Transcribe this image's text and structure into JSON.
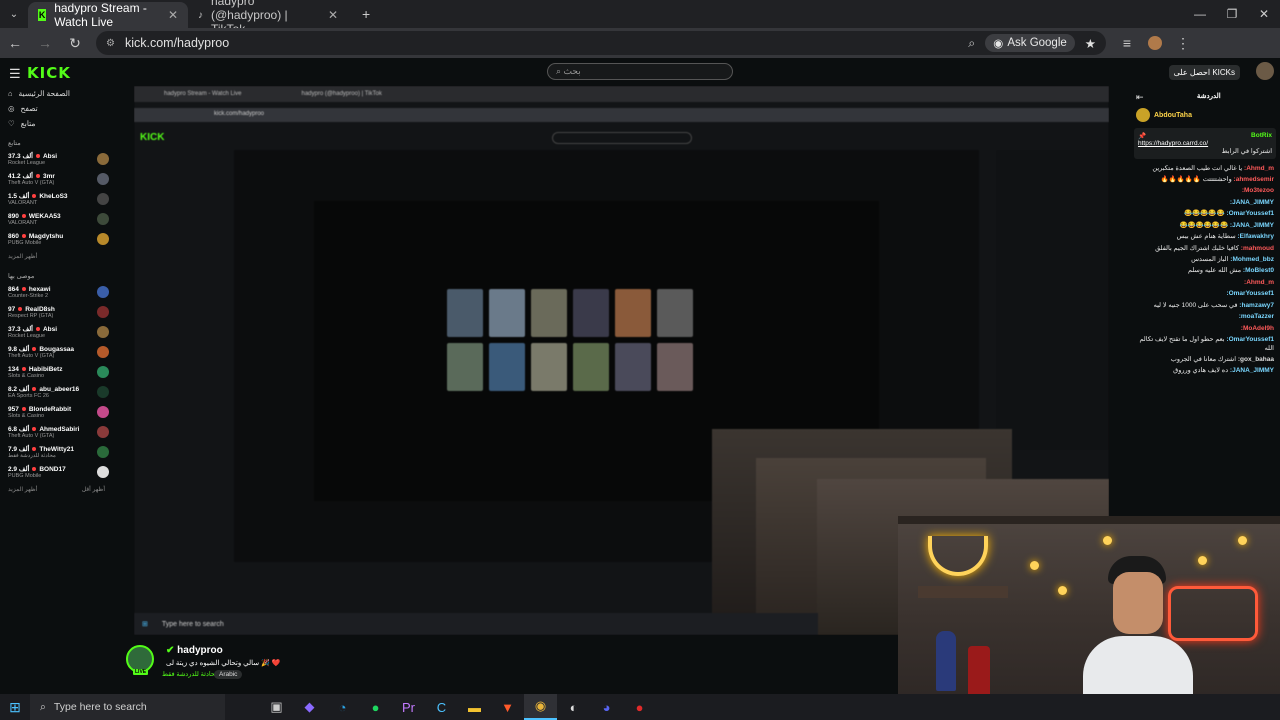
{
  "browser": {
    "tabs": [
      {
        "label": "hadypro Stream - Watch Live",
        "active": true
      },
      {
        "label": "hadypro (@hadyproo) | TikTok",
        "active": false
      }
    ],
    "url": "kick.com/hadyproo",
    "ask_google": "Ask Google"
  },
  "kick": {
    "logo": "KICK",
    "search_placeholder": "بحث",
    "get_kicks": "احصل على KICKs",
    "nav": [
      {
        "label": "الصفحة الرئيسية",
        "icon": "home-icon"
      },
      {
        "label": "تصفح",
        "icon": "compass-icon"
      },
      {
        "label": "متابع",
        "icon": "heart-icon"
      }
    ],
    "following_header": "متابع",
    "following": [
      {
        "name": "Absi",
        "count": "37.3 ألف",
        "category": "Rocket League",
        "color": "#8a6a3a"
      },
      {
        "name": "3mr",
        "count": "41.2 ألف",
        "category": "Theft Auto V (GTA)",
        "color": "#555a66"
      },
      {
        "name": "KheLoS3",
        "count": "1.5 ألف",
        "category": "VALORANT",
        "color": "#444"
      },
      {
        "name": "WEKAA53",
        "count": "890",
        "category": "VALORANT",
        "color": "#3d4a3a"
      },
      {
        "name": "Magdytshu",
        "count": "860",
        "category": "PUBG Mobile",
        "color": "#b8892a"
      }
    ],
    "show_more_1": "أظهر المزيد",
    "recommended_header": "موصى بها",
    "recommended": [
      {
        "name": "hexawi",
        "count": "864",
        "category": "Counter-Strike 2",
        "color": "#3a5ea8"
      },
      {
        "name": "RealD8sh",
        "count": "97",
        "category": "Respect RP (GTA)",
        "color": "#7a2a2a"
      },
      {
        "name": "Absi",
        "count": "37.3 ألف",
        "category": "Rocket League",
        "color": "#8a6a3a"
      },
      {
        "name": "Bougassaa",
        "count": "9.8 ألف",
        "category": "Theft Auto V (GTA)",
        "color": "#b55a2a"
      },
      {
        "name": "HabibiBetz",
        "count": "134",
        "category": "Slots & Casino",
        "color": "#2a8a5a"
      },
      {
        "name": "abu_abeer16",
        "count": "8.2 ألف",
        "category": "EA Sports FC 26",
        "color": "#1a3a2a"
      },
      {
        "name": "BlondeRabbit",
        "count": "957",
        "category": "Slots & Casino",
        "color": "#c44a8a"
      },
      {
        "name": "AhmedSabiri",
        "count": "6.8 ألف",
        "category": "Theft Auto V (GTA)",
        "color": "#8a3a3a"
      },
      {
        "name": "TheWitty21",
        "count": "7.9 ألف",
        "category": "محادثة للدردشة فقط",
        "color": "#2a6a3a"
      },
      {
        "name": "BOND17",
        "count": "2.9 ألف",
        "category": "PUBG Mobile",
        "color": "#ddd"
      }
    ],
    "show_more_2": "أظهر المزيد",
    "show_less": "أظهر أقل"
  },
  "chat": {
    "title": "الدردشة",
    "top_user": "AbdouTaha",
    "pinned_user": "BotRix",
    "pinned_link": "https://hadypro.carrd.co/",
    "pinned_text": "اشتركوا في الرابط",
    "messages": [
      {
        "user": "Ahmd_m",
        "text": "يا غالي انت طيب الصعدة متكبرين",
        "color": "#ff5a5a"
      },
      {
        "user": "ahmedsemir",
        "text": "واحشتتتتت 🔥🔥🔥🔥🔥",
        "color": "#ff5a5a"
      },
      {
        "user": "Mo3tezoo",
        "text": "",
        "color": "#ff5a5a"
      },
      {
        "user": "JANA_JIMMY",
        "text": "",
        "color": "#7ad7ff"
      },
      {
        "user": "OmarYoussef1",
        "text": "😂😂😂😂😂",
        "color": "#7ad7ff"
      },
      {
        "user": "JANA_JIMMY",
        "text": "😂😂😂😂😂😂",
        "color": "#7ad7ff"
      },
      {
        "user": "Elfawakhry",
        "text": "سطاية هنام عش بيس",
        "color": "#7ad7ff"
      },
      {
        "user": "mahmoud",
        "text": "كافيا خلبك اشتراك الجيم بالفلق",
        "color": "#ff5a5a"
      },
      {
        "user": "Mohmed_bbz",
        "text": "الباز المسدس",
        "color": "#7ad7ff"
      },
      {
        "user": "MoBlest0",
        "text": "مش الله عليه وسلم",
        "color": "#7ad7ff"
      },
      {
        "user": "Ahmd_m",
        "text": "",
        "color": "#ff5a5a"
      },
      {
        "user": "OmarYoussef1",
        "text": "",
        "color": "#7ad7ff"
      },
      {
        "user": "hamzawy7",
        "text": "في سحب على 1000 جنيه لا ليه",
        "color": "#7ad7ff"
      },
      {
        "user": "moaTazzer",
        "text": "",
        "color": "#7ad7ff"
      },
      {
        "user": "MoAdel9h",
        "text": "",
        "color": "#ff5a5a"
      },
      {
        "user": "OmarYoussef1",
        "text": "بعم حطو اول ما تقتح لايف تكالم الله",
        "color": "#7ad7ff"
      },
      {
        "user": "gox_bahaa",
        "text": "اشترك معانا في الجروب",
        "color": "#ddd"
      },
      {
        "user": "JANA_JIMMY",
        "text": "ده لايف هادي ورروق",
        "color": "#7ad7ff"
      }
    ]
  },
  "stream": {
    "name": "hadyproo",
    "title": "سالي وتحالي الشيوه دي زيتة لى 🎉 ❤️",
    "category": "محادثة للدردشة فقط",
    "tag": "Arabic",
    "live": "LIVE"
  },
  "taskbar": {
    "search_placeholder": "Type here to search",
    "icons": [
      "task-view-icon",
      "copilot-icon",
      "edge-icon",
      "spotify-icon",
      "premiere-icon",
      "ccleaner-icon",
      "explorer-icon",
      "brave-icon",
      "chrome-icon",
      "obs-icon",
      "discord-icon",
      "red-app-icon"
    ]
  }
}
